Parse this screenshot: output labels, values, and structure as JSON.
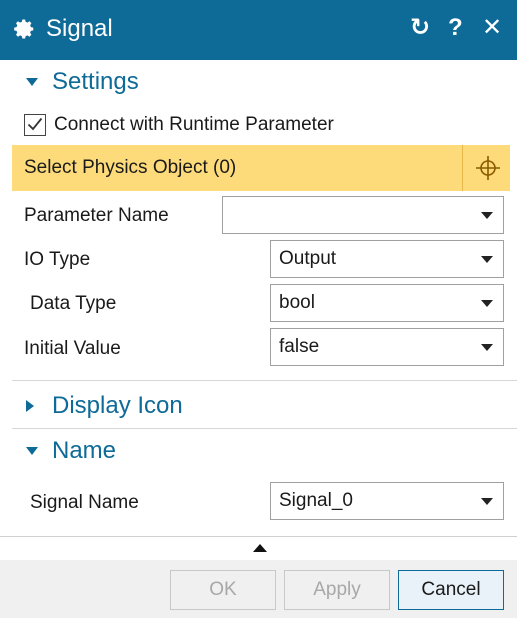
{
  "dialog": {
    "title": "Signal",
    "icons": [
      "gear-icon",
      "reset-icon",
      "help-icon",
      "close-icon"
    ],
    "reset_glyph": "↻",
    "help_glyph": "?",
    "close_glyph": "✕"
  },
  "settings": {
    "header": "Settings",
    "connect_checkbox": {
      "label": "Connect with Runtime Parameter",
      "checked": true
    },
    "select_physics": {
      "label": "Select Physics Object (0)"
    },
    "parameter_name": {
      "label": "Parameter Name",
      "value": ""
    },
    "io_type": {
      "label": "IO Type",
      "value": "Output"
    },
    "data_type": {
      "label": "Data Type",
      "value": "bool"
    },
    "initial_value": {
      "label": "Initial Value",
      "value": "false"
    }
  },
  "display_icon": {
    "header": "Display Icon",
    "expanded": false
  },
  "name": {
    "header": "Name",
    "signal_name": {
      "label": "Signal Name",
      "value": "Signal_0"
    }
  },
  "buttons": {
    "ok": "OK",
    "apply": "Apply",
    "cancel": "Cancel"
  },
  "colors": {
    "title_bar": "#0e6a97",
    "accent": "#0e6a97",
    "highlight": "#fddb7a"
  }
}
